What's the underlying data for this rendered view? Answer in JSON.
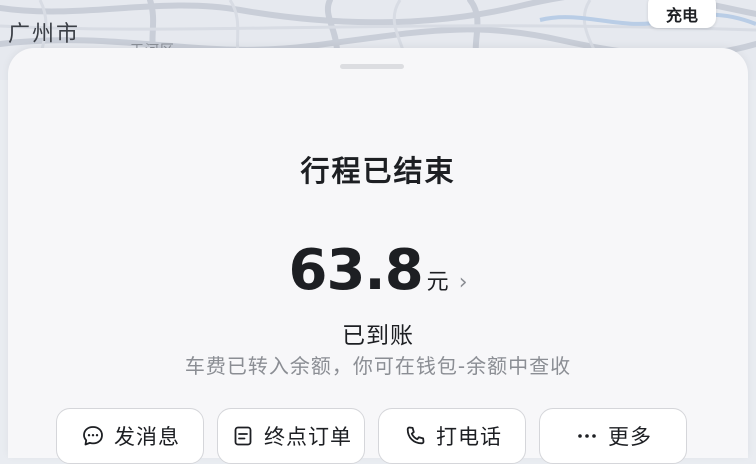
{
  "map": {
    "city_label": "广州市",
    "district_label": "天河区",
    "charge_chip_label": "充电"
  },
  "sheet": {
    "title": "行程已结束",
    "fare": {
      "amount": "63.8",
      "unit": "元",
      "arrow": "›"
    },
    "status": {
      "main": "已到账",
      "sub": "车费已转入余额，你可在钱包-余额中查收"
    },
    "actions": [
      {
        "label": "发消息",
        "icon": "chat-bubble-icon"
      },
      {
        "label": "终点订单",
        "icon": "document-icon"
      },
      {
        "label": "打电话",
        "icon": "phone-icon"
      },
      {
        "label": "更多",
        "icon": "more-dots-icon"
      }
    ]
  },
  "colors": {
    "text_primary": "#1d1f23",
    "text_secondary": "#8b8e94",
    "sheet_bg": "#f7f7f9",
    "button_border": "#d5d6da"
  }
}
